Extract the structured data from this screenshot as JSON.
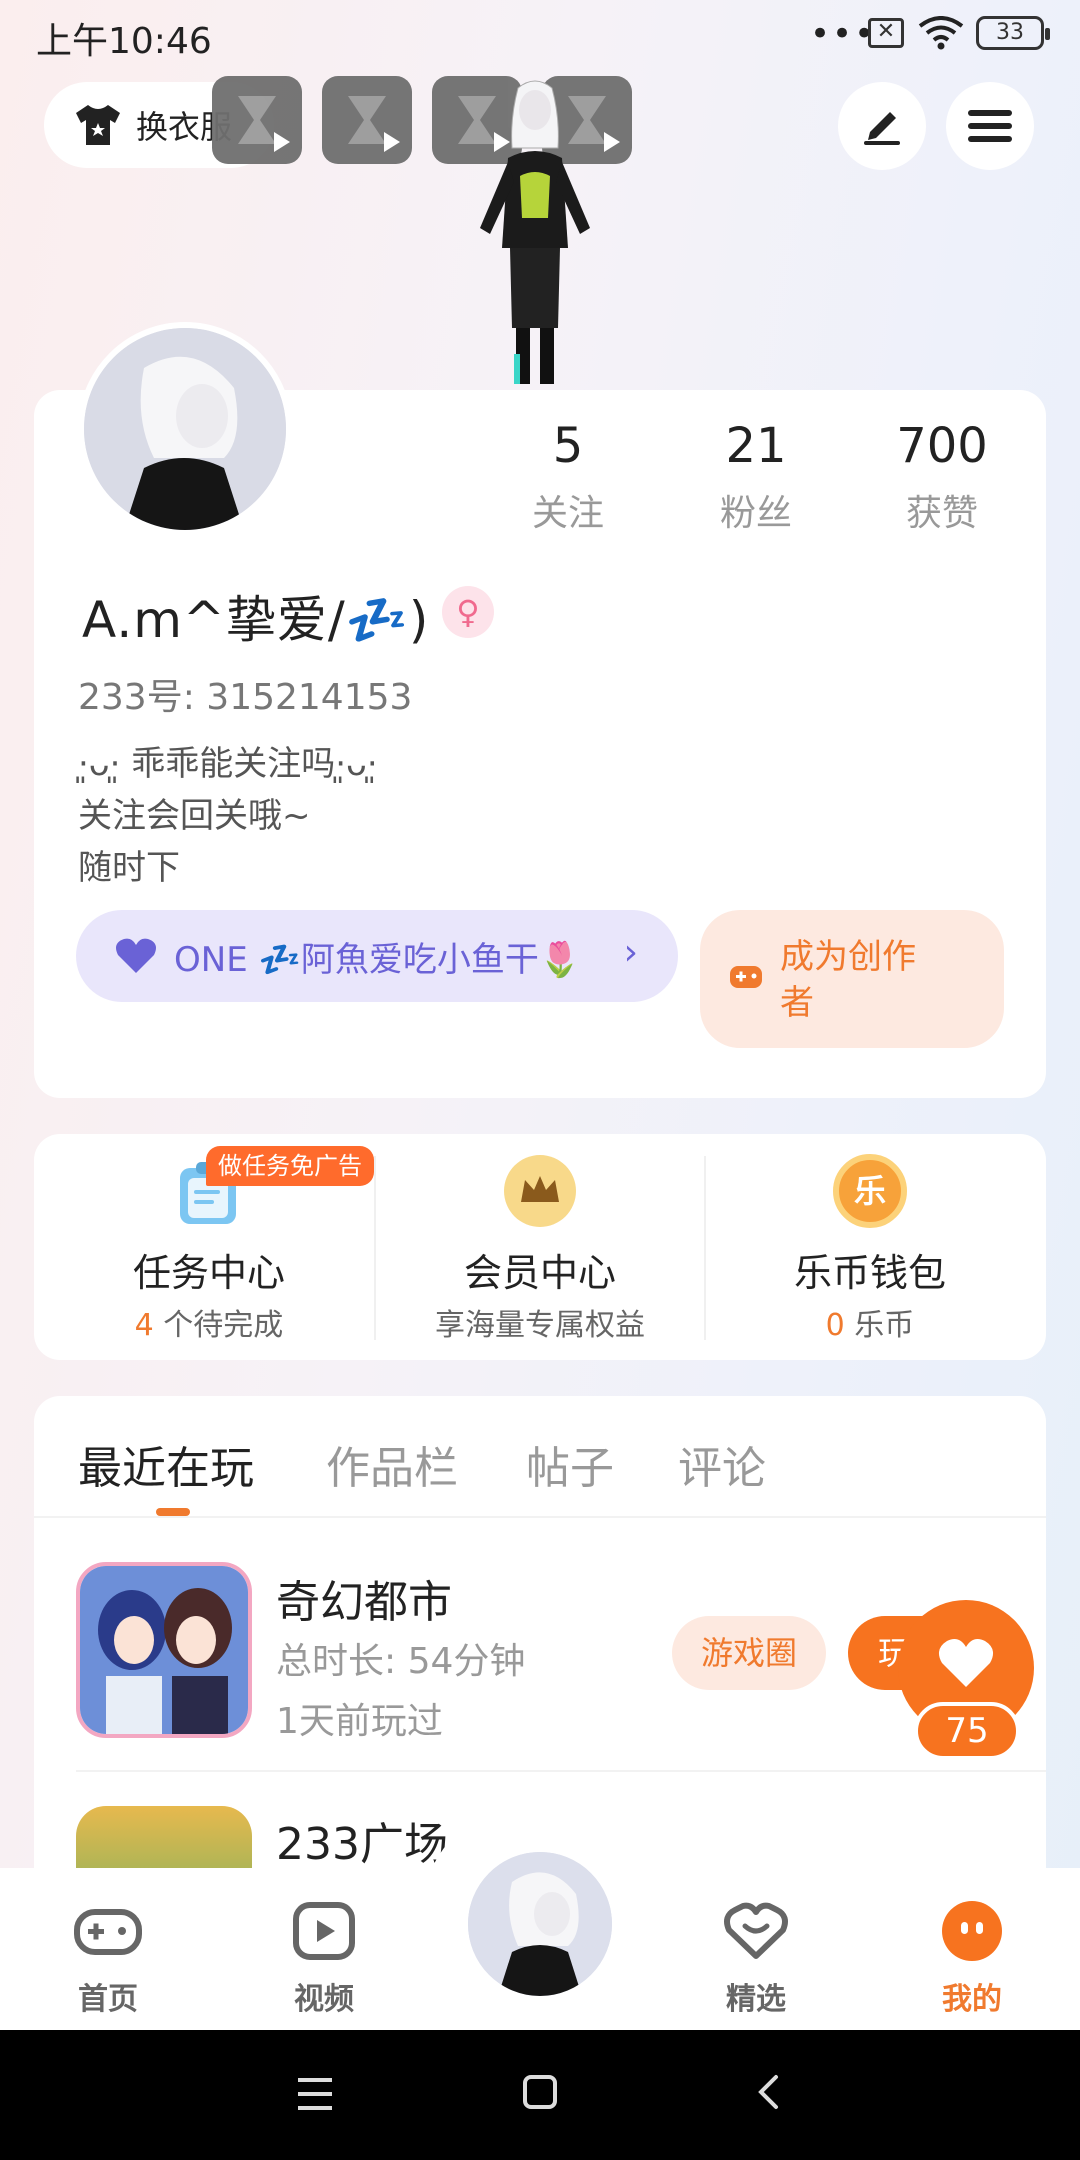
{
  "status_bar": {
    "time": "上午10:46",
    "battery": "33",
    "sim": "✕",
    "more": "•••"
  },
  "top": {
    "dress_label": "换衣服"
  },
  "stats": [
    {
      "value": "5",
      "label": "关注"
    },
    {
      "value": "21",
      "label": "粉丝"
    },
    {
      "value": "700",
      "label": "获赞"
    }
  ],
  "profile": {
    "username": "A.m^挚爱/💤)",
    "gender_symbol": "♀",
    "uid": "233号: 315214153",
    "bio_line1": "·͈ᴗ·͈ 乖乖能关注吗·͈ᴗ·͈",
    "bio_line2": "关注会回关哦~",
    "bio_line3": "随时下"
  },
  "group": {
    "label": "ONE 💤阿魚爱吃小鱼干🌷",
    "chevron": "›"
  },
  "creator": {
    "line1": "成为创作",
    "line2": "者"
  },
  "quick": {
    "badge": "做任务免广告",
    "task_title": "任务中心",
    "task_count": "4",
    "task_sub": " 个待完成",
    "vip_title": "会员中心",
    "vip_sub": "享海量专属权益",
    "wallet_title": "乐币钱包",
    "wallet_count": "0",
    "wallet_sub": " 乐币",
    "wallet_icon_char": "乐"
  },
  "tabs": [
    "最近在玩",
    "作品栏",
    "帖子",
    "评论"
  ],
  "games": [
    {
      "name": "奇幻都市",
      "duration": "总时长: 54分钟",
      "last": "1天前玩过",
      "circle_btn": "游戏圈",
      "play_btn": "玩"
    },
    {
      "name": "233广场"
    }
  ],
  "fab": {
    "count": "75"
  },
  "nav": [
    {
      "label": "首页",
      "icon": "gamepad-icon"
    },
    {
      "label": "视频",
      "icon": "video-icon"
    },
    {
      "label": "",
      "icon": "avatar"
    },
    {
      "label": "精选",
      "icon": "heart-box-icon"
    },
    {
      "label": "我的",
      "icon": "face-icon"
    }
  ],
  "colors": {
    "accent": "#f7731f",
    "purple": "#6a62d6",
    "pink": "#f06a8e"
  }
}
